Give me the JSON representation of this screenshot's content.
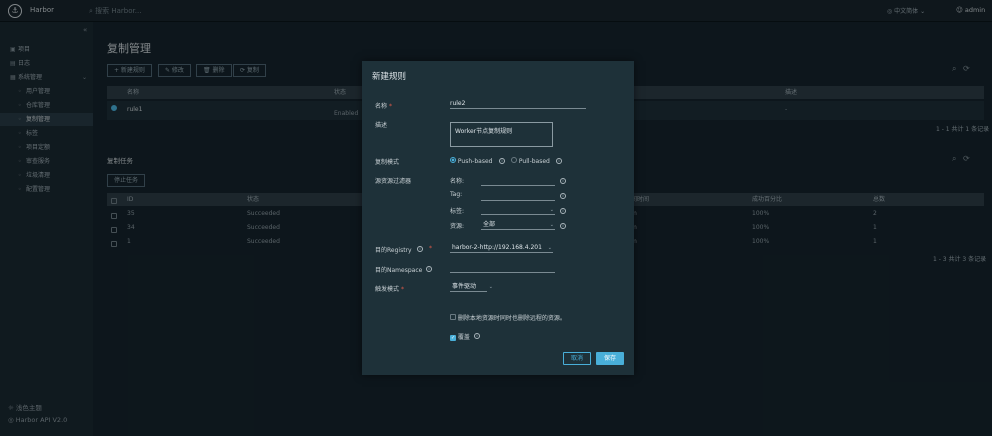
{
  "topbar": {
    "brand": "Harbor",
    "search_placeholder": "搜索 Harbor...",
    "language": "中文简体",
    "user": "admin"
  },
  "sidebar": {
    "items": [
      {
        "icon": "project-icon",
        "label": "项目"
      },
      {
        "icon": "log-icon",
        "label": "日志"
      },
      {
        "icon": "admin-icon",
        "label": "系统管理"
      }
    ],
    "subitems": [
      "用户管理",
      "仓库管理",
      "复制管理",
      "标签",
      "项目定额",
      "审查服务",
      "垃圾清理",
      "配置管理"
    ],
    "active": "复制管理",
    "theme": "浅色主题",
    "api": "Harbor API V2.0"
  },
  "page": {
    "title": "复制管理",
    "toolbar": [
      "+ 新建规则",
      "✎ 修改",
      "🗑 删除",
      "⟳ 复制"
    ],
    "rules_table": {
      "headers": [
        "名称",
        "状态",
        "描述"
      ],
      "rows": [
        {
          "name": "rule1",
          "status": "Enabled",
          "desc": "-"
        }
      ],
      "footer": "1 - 1 共计 1 条记录"
    },
    "tasks_title": "复制任务",
    "tasks_stop": "停止任务",
    "tasks_table": {
      "headers": [
        "ID",
        "状态",
        "间时间",
        "成功百分比",
        "总数"
      ],
      "rows": [
        {
          "id": "35",
          "status": "Succeeded",
          "time": "m",
          "pct": "100%",
          "total": "2"
        },
        {
          "id": "34",
          "status": "Succeeded",
          "time": "m",
          "pct": "100%",
          "total": "1"
        },
        {
          "id": "1",
          "status": "Succeeded",
          "time": "m",
          "pct": "100%",
          "total": "1"
        }
      ],
      "footer": "1 - 3 共计 3 条记录"
    }
  },
  "modal": {
    "title": "新建规则",
    "name_label": "名称",
    "name_value": "rule2",
    "desc_label": "描述",
    "desc_value": "Worker节点复制规则",
    "mode_label": "复制模式",
    "mode_push": "Push-based",
    "mode_pull": "Pull-based",
    "filter_label": "源资源过滤器",
    "filter_name": "名称:",
    "filter_tag": "Tag:",
    "filter_label_lbl": "标签:",
    "filter_resource": "资源:",
    "filter_resource_value": "全部",
    "dest_registry_label": "目的Registry",
    "dest_registry_value": "harbor-2-http://192.168.4.201",
    "dest_namespace_label": "目的Namespace",
    "trigger_label": "触发模式",
    "trigger_value": "事件驱动",
    "delete_remote": "删除本地资源时同时也删除远程的资源。",
    "override": "覆盖",
    "cancel": "取消",
    "save": "保存"
  },
  "colors": {
    "accent": "#49afd9",
    "modal_bg": "#1e3139",
    "save_btn": "#49afd9"
  }
}
